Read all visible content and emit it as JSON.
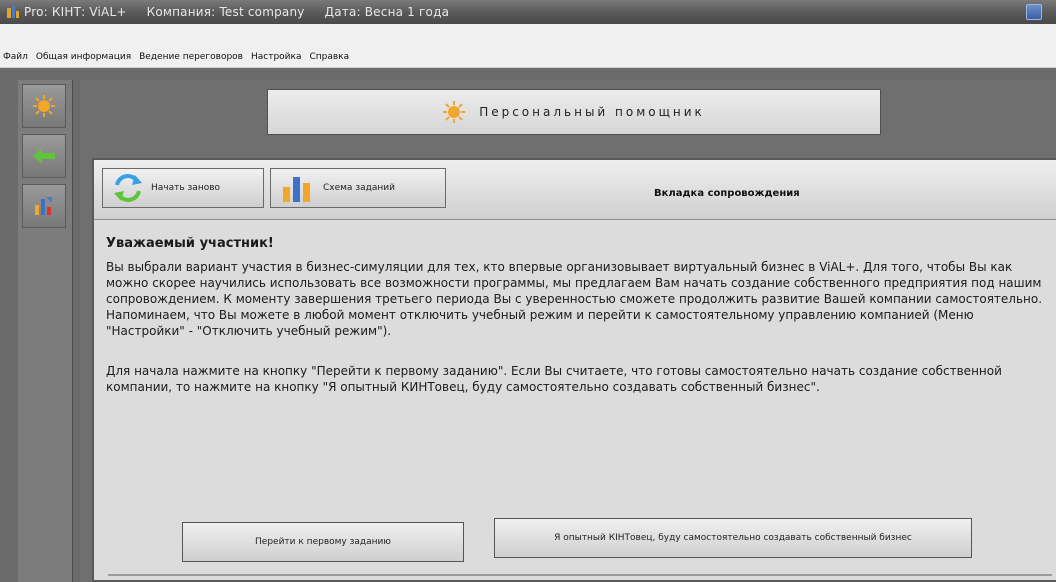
{
  "window": {
    "title_app": "Pro: КІНТ: ViAL+",
    "title_company": "Компания: Test company",
    "title_date": "Дата: Весна 1 года"
  },
  "menu": {
    "items": [
      "Файл",
      "Общая информация",
      "Ведение переговоров",
      "Настройка",
      "Справка"
    ]
  },
  "assistant": {
    "label": "Персональный помощник"
  },
  "panel": {
    "restart_label": "Начать заново",
    "scheme_label": "Схема заданий",
    "tab_title": "Вкладка сопровождения",
    "greeting": "Уважаемый участник!",
    "paragraph1": "Вы выбрали вариант участия в бизнес-симуляции для тех, кто впервые организовывает виртуальный бизнес в ViAL+. Для того, чтобы Вы как можно скорее научились использовать все возможности программы, мы предлагаем Вам начать создание собственного предприятия под нашим сопровождением. К моменту завершения третьего периода Вы с уверенностью сможете продолжить развитие Вашей компании самостоятельно. Напоминаем, что Вы можете в любой момент отключить учебный режим и перейти к самостоятельному управлению компанией (Меню \"Настройки\" - \"Отключить учебный режим\").",
    "paragraph2": "Для начала нажмите на кнопку \"Перейти к первому заданию\". Если Вы считаете, что готовы самостоятельно начать создание собственной компании, то нажмите на кнопку \"Я опытный КИНТовец, буду самостоятельно создавать собственный бизнес\".",
    "first_task_label": "Перейти к первому заданию",
    "experienced_label": "Я опытный КІНТовец, буду самостоятельно создавать собственный бизнес"
  },
  "colors": {
    "title_bar": "#5a5a5a",
    "workspace": "#6f6f6f",
    "panel": "#dcdcdc"
  }
}
